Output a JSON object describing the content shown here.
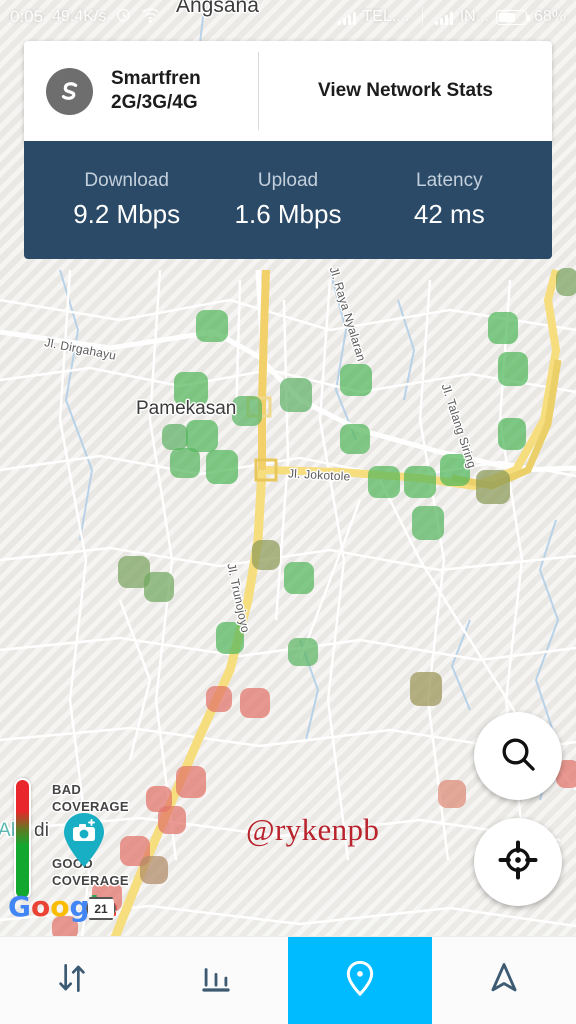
{
  "status_bar": {
    "time": "0:05",
    "network_speed": "49.4K/s",
    "alarm_icon": "alarm-clock-icon",
    "wifi_icon": "wifi-icon",
    "sim1_label": "TEL....",
    "sim2_label": "IN...",
    "battery_percent": "68%"
  },
  "card": {
    "carrier_name_line1": "Smartfren",
    "carrier_name_line2": "2G/3G/4G",
    "carrier_logo_icon": "smartfren-logo-icon",
    "network_stats_label": "View Network Stats",
    "metrics": [
      {
        "label": "Download",
        "value": "9.2 Mbps"
      },
      {
        "label": "Upload",
        "value": "1.6 Mbps"
      },
      {
        "label": "Latency",
        "value": "42 ms"
      }
    ],
    "panel_color": "#2a4a68"
  },
  "map": {
    "city_label": "Pamekasan",
    "top_label": "Angsana",
    "street_labels": [
      "Jl. Dirgahayu",
      "Jl. Raya Nyalaran",
      "Jl. Jokotole",
      "Jl. Talang Siring",
      "Jl. Trunojoyo"
    ],
    "partial_label_left": "Ab",
    "partial_label_left2": "di",
    "attribution": "Google",
    "road_shield": "21",
    "watermark": "@rykenpb",
    "legend": {
      "bad_line1": "BAD",
      "bad_line2": "COVERAGE",
      "good_line1": "GOOD",
      "good_line2": "COVERAGE",
      "bad_color": "#e8262b",
      "good_color": "#12a830"
    },
    "camera_pin_icon": "camera-pin-icon",
    "coverage_good_color": "#4caf50",
    "coverage_bad_color": "#e8564a"
  },
  "fabs": [
    {
      "name": "search-fab",
      "icon": "search-icon"
    },
    {
      "name": "locate-fab",
      "icon": "crosshair-icon"
    }
  ],
  "bottom_nav": {
    "active_color": "#00bbff",
    "items": [
      {
        "name": "tab-speedtest",
        "icon": "up-down-arrows-icon",
        "active": false
      },
      {
        "name": "tab-stats",
        "icon": "bar-chart-icon",
        "active": false
      },
      {
        "name": "tab-map",
        "icon": "map-pin-icon",
        "active": true
      },
      {
        "name": "tab-navigate",
        "icon": "navigation-arrow-icon",
        "active": false
      }
    ]
  }
}
